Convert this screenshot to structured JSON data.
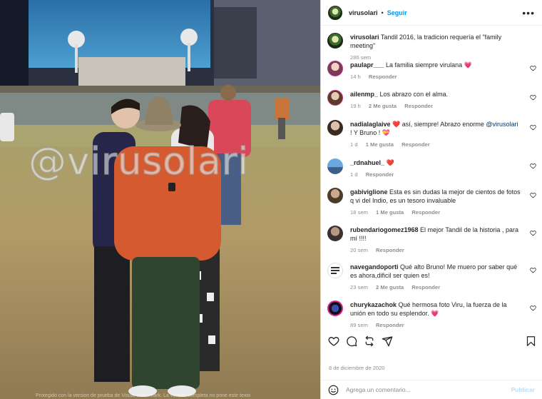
{
  "photo": {
    "watermark": "@virusolari",
    "caption": "Protegido con la version de prueba de Visual Watermark. La version completa no pone este texto"
  },
  "header": {
    "username": "virusolari",
    "separator": "•",
    "follow_label": "Seguir",
    "more_icon": "more-horizontal-icon",
    "more_label": "•••"
  },
  "caption": {
    "username": "virusolari",
    "text": "Tandil 2016, la tradicion requería el \"family meeting\"",
    "time": "286 sem"
  },
  "comments": [
    {
      "username": "paulapr___",
      "text": "La familia siempre virulana",
      "emoji": "💗",
      "time": "14 h",
      "likes": "",
      "reply": "Responder"
    },
    {
      "username": "ailenmp_",
      "text": "Los abrazo con el alma.",
      "emoji": "",
      "time": "19 h",
      "likes": "2 Me gusta",
      "reply": "Responder"
    },
    {
      "username": "nadialaglaive",
      "pre_emoji": "❤️",
      "text": "así, siempre! Abrazo enorme",
      "mention": "@virusolari",
      "text2": "! Y Bruno !",
      "emoji": "💝",
      "time": "1 d",
      "likes": "1 Me gusta",
      "reply": "Responder"
    },
    {
      "username": "_rdnahuel_",
      "text": "",
      "emoji": "❤️",
      "time": "1 d",
      "likes": "",
      "reply": "Responder"
    },
    {
      "username": "gabiviglione",
      "text": "Esta es sin dudas la mejor de cientos de fotos q vi del Indio, es un tesoro invaluable",
      "emoji": "",
      "time": "18 sem",
      "likes": "1 Me gusta",
      "reply": "Responder"
    },
    {
      "username": "rubendariogomez1968",
      "text": "El mejor Tandil de la historia , para mí !!!!",
      "emoji": "",
      "time": "20 sem",
      "likes": "",
      "reply": "Responder"
    },
    {
      "username": "navegandoporti",
      "text": "Qué alto Bruno! Me muero por saber qué es ahora,dificil ser quien es!",
      "emoji": "",
      "time": "23 sem",
      "likes": "2 Me gusta",
      "reply": "Responder"
    },
    {
      "username": "churykazachok",
      "text": "Qué hermosa foto Viru, la fuerza de la unión en todo su esplendor.",
      "emoji": "💗",
      "time": "89 sem",
      "likes": "",
      "reply": "Responder"
    }
  ],
  "actions": {
    "like_icon": "heart-icon",
    "comment_icon": "comment-icon",
    "repost_icon": "repost-icon",
    "share_icon": "share-icon",
    "save_icon": "bookmark-icon"
  },
  "date": "8 de diciembre de 2020",
  "add_comment": {
    "placeholder": "Agrega un comentario...",
    "post_label": "Publicar",
    "emoji_icon": "smiley-icon"
  },
  "colors": {
    "link": "#0095f6",
    "muted": "#8e8e8e",
    "mention": "#00376b"
  }
}
